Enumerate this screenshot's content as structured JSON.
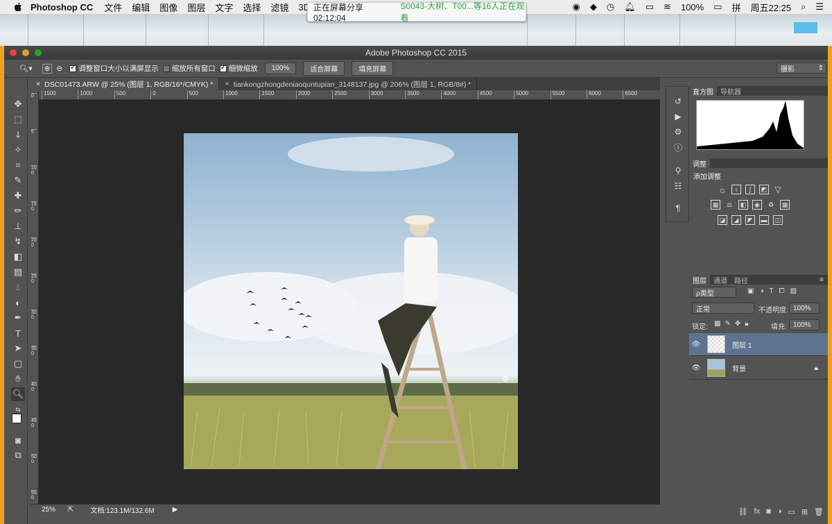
{
  "menubar": {
    "app_name": "Photoshop CC",
    "items": [
      "文件",
      "编辑",
      "图像",
      "图层",
      "文字",
      "选择",
      "滤镜",
      "3D"
    ],
    "battery": "100%",
    "ime": "拼",
    "clock": "周五22:25"
  },
  "share_banner": {
    "prefix": "正在屏幕分享 02:12:04",
    "viewers": "S0043-大树、T00...等16人正在观看"
  },
  "window": {
    "title": "Adobe Photoshop CC 2015"
  },
  "options_bar": {
    "resize_windows": "调整窗口大小以满屏显示",
    "zoom_all": "缩放所有窗口",
    "scrubby_zoom": "细微缩放",
    "btn_100": "100%",
    "btn_fit": "适合屏幕",
    "btn_fill": "填充屏幕",
    "workspace": "摄影"
  },
  "tabs": [
    {
      "label": "DSC01473.ARW @ 25% (图层 1, RGB/16*/CMYK) *",
      "close": "×"
    },
    {
      "label": "tiankongzhongdeniaoquntupian_3148137.jpg @ 206% (图层 1, RGB/8#) *",
      "close": "×"
    }
  ],
  "ruler_h": [
    "1500",
    "1000",
    "500",
    "0",
    "500",
    "1000",
    "1500",
    "2000",
    "2500",
    "3000",
    "3500",
    "4000",
    "4500",
    "5000",
    "5500",
    "6000",
    "6500"
  ],
  "ruler_v": [
    "0",
    "5",
    "1 0 0",
    "1 5 0",
    "2 0 0",
    "2 5 0",
    "3 0 0",
    "3 5 0",
    "4 0 0",
    "4 5 0",
    "5 0 0",
    "5 5 0"
  ],
  "status": {
    "zoom": "25%",
    "doc": "文档:123.1M/132.6M"
  },
  "panels": {
    "histogram_tab": "直方图",
    "navigator_tab": "导航器",
    "adjustments_tab": "调整",
    "add_adjustment": "添加调整",
    "layers_tab": "图层",
    "channels_tab": "通道",
    "paths_tab": "路径",
    "filter_kind": "ρ类型",
    "blend_mode": "正常",
    "opacity_label": "不透明度:",
    "opacity": "100%",
    "lock_label": "锁定:",
    "fill_label": "填充:",
    "fill": "100%"
  },
  "layers": [
    {
      "name": "图层 1",
      "active": true
    },
    {
      "name": "背景",
      "active": false
    }
  ],
  "colors": {
    "accent": "#f0a020",
    "panel": "#535353",
    "active_layer": "#5f7391",
    "share_green": "#2aa33a"
  }
}
